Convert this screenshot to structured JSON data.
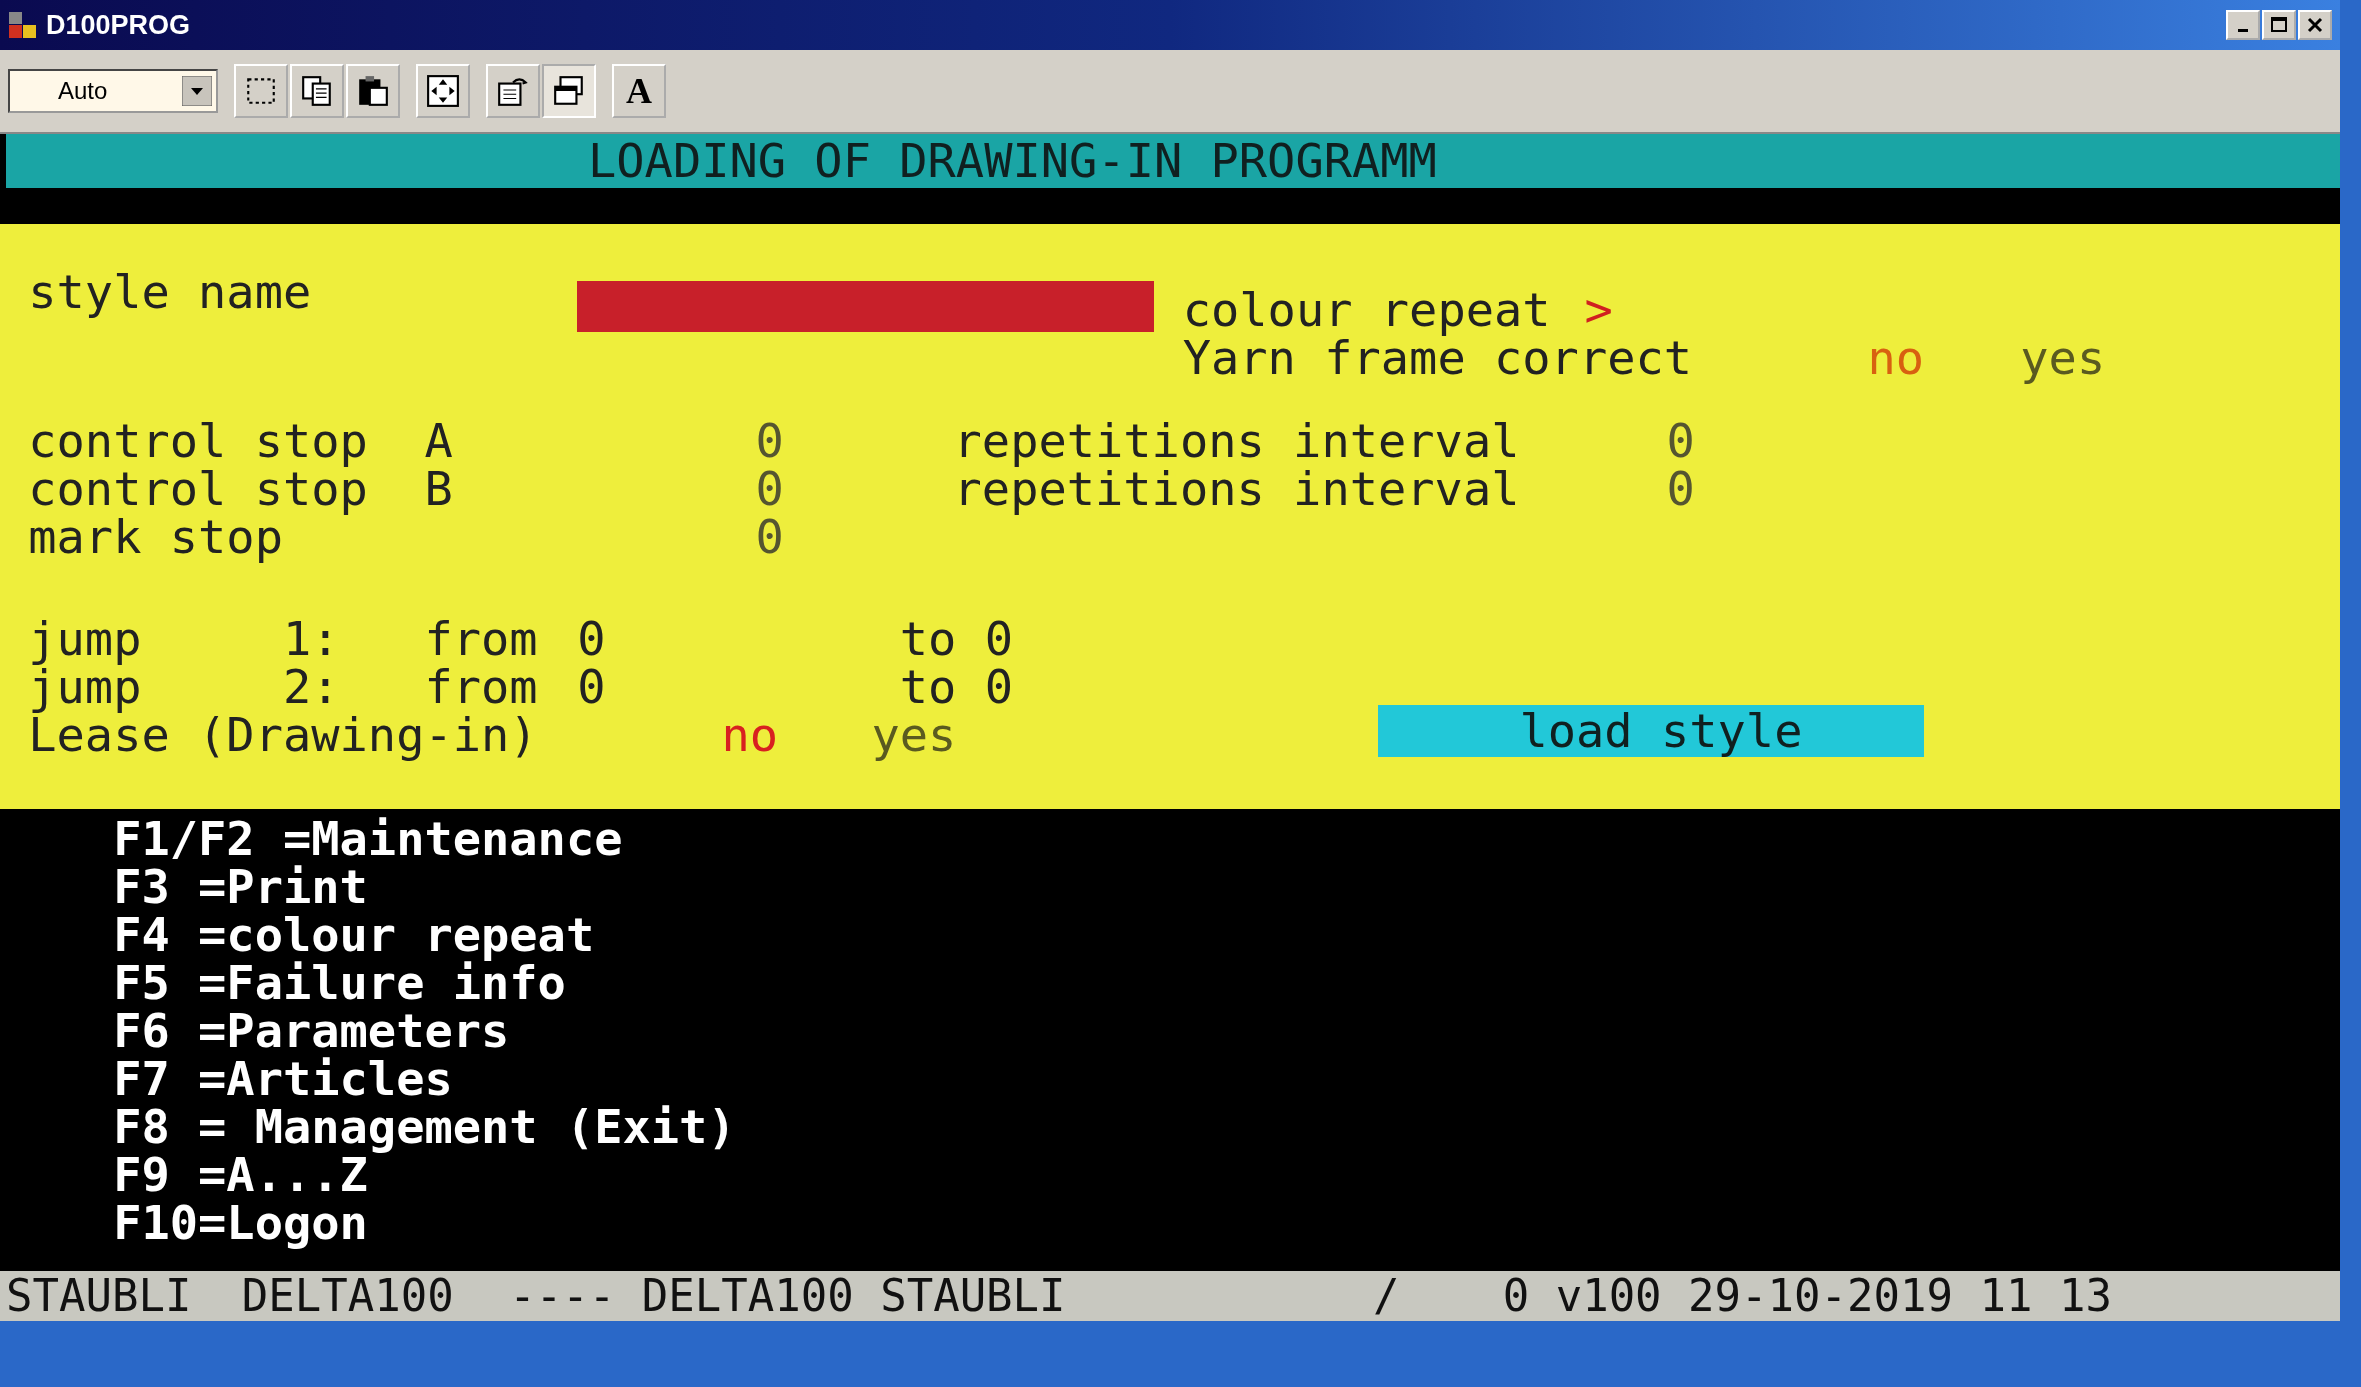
{
  "window": {
    "title": "D100PROG"
  },
  "toolbar": {
    "zoom_select": {
      "value": "Auto"
    },
    "font_button": "A"
  },
  "header": {
    "title": "LOADING OF DRAWING-IN PROGRAMM"
  },
  "form": {
    "style_name": {
      "label": "style name"
    },
    "colour_repeat": {
      "label": "colour repeat",
      "marker": ">"
    },
    "yarn_frame_correct": {
      "label": "Yarn frame correct",
      "options": [
        {
          "label": "no",
          "selected": true
        },
        {
          "label": "yes",
          "selected": false
        }
      ]
    },
    "control_stops": [
      {
        "label": "control stop",
        "letter": "A",
        "value": "0",
        "interval_label": "repetitions interval",
        "interval_value": "0"
      },
      {
        "label": "control stop",
        "letter": "B",
        "value": "0",
        "interval_label": "repetitions interval",
        "interval_value": "0"
      }
    ],
    "mark_stop": {
      "label": "mark stop",
      "value": "0"
    },
    "jumps": [
      {
        "label": "jump",
        "number": "1:",
        "from_label": "from",
        "from_value": "0",
        "to_label": "to",
        "to_value": "0"
      },
      {
        "label": "jump",
        "number": "2:",
        "from_label": "from",
        "from_value": "0",
        "to_label": "to",
        "to_value": "0"
      }
    ],
    "lease": {
      "label": "Lease (Drawing-in)",
      "options": [
        {
          "label": "no",
          "selected": true
        },
        {
          "label": "yes",
          "selected": false
        }
      ]
    },
    "load_button": "load style"
  },
  "function_keys": [
    "F1/F2 =Maintenance",
    "F3 =Print",
    "F4 =colour repeat",
    "F5 =Failure info",
    "F6 =Parameters",
    "F7 =Articles",
    "F8 = Management (Exit)",
    "F9 =A...Z",
    "F10=Logon"
  ],
  "status_bar": [
    "STAUBLI",
    "DELTA100",
    "---- DELTA100 STAUBLI",
    "/",
    "0 v100 29-10-2019 11 13"
  ]
}
